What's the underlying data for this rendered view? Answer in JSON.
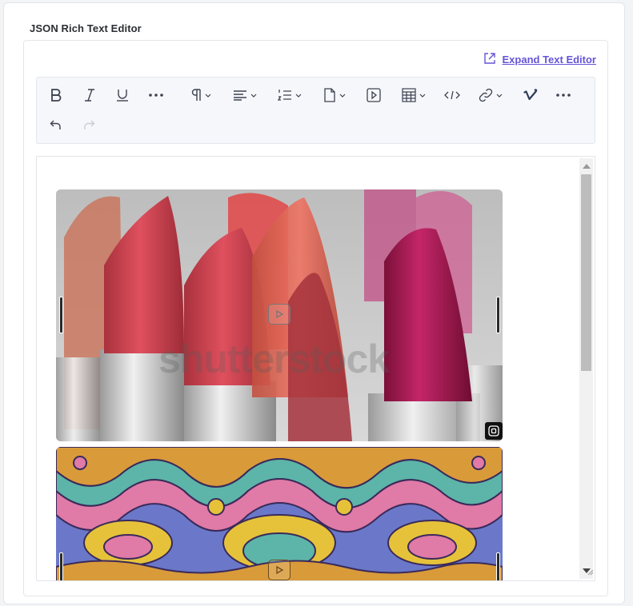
{
  "field": {
    "label": "JSON Rich Text Editor"
  },
  "expand": {
    "label": "Expand Text Editor",
    "icon": "expand-icon"
  },
  "toolbar": {
    "row1": [
      {
        "name": "bold-button",
        "icon": "bold-icon"
      },
      {
        "name": "italic-button",
        "icon": "italic-icon"
      },
      {
        "name": "underline-button",
        "icon": "underline-icon"
      },
      {
        "name": "more-formatting-button",
        "icon": "ellipsis-icon"
      },
      {
        "name": "paragraph-dropdown",
        "icon": "paragraph-icon"
      },
      {
        "name": "align-dropdown",
        "icon": "align-left-icon"
      },
      {
        "name": "list-dropdown",
        "icon": "ordered-list-icon"
      },
      {
        "name": "asset-dropdown",
        "icon": "file-icon"
      },
      {
        "name": "embed-video-button",
        "icon": "play-square-icon"
      },
      {
        "name": "table-dropdown",
        "icon": "table-icon"
      },
      {
        "name": "code-button",
        "icon": "code-icon"
      },
      {
        "name": "link-dropdown",
        "icon": "link-icon"
      },
      {
        "name": "vimeo-button",
        "icon": "vimeo-icon"
      },
      {
        "name": "more-button",
        "icon": "ellipsis-icon"
      }
    ],
    "row2": [
      {
        "name": "undo-button",
        "icon": "undo-icon"
      },
      {
        "name": "redo-button",
        "icon": "redo-icon",
        "disabled": true
      }
    ]
  },
  "editor": {
    "media": [
      {
        "name": "lipstick-video-embed",
        "watermark": "shutterstock"
      },
      {
        "name": "kaleidoscope-video-embed"
      }
    ]
  },
  "colors": {
    "accent": "#6654d6",
    "toolbar_bg": "#f5f7fb"
  }
}
